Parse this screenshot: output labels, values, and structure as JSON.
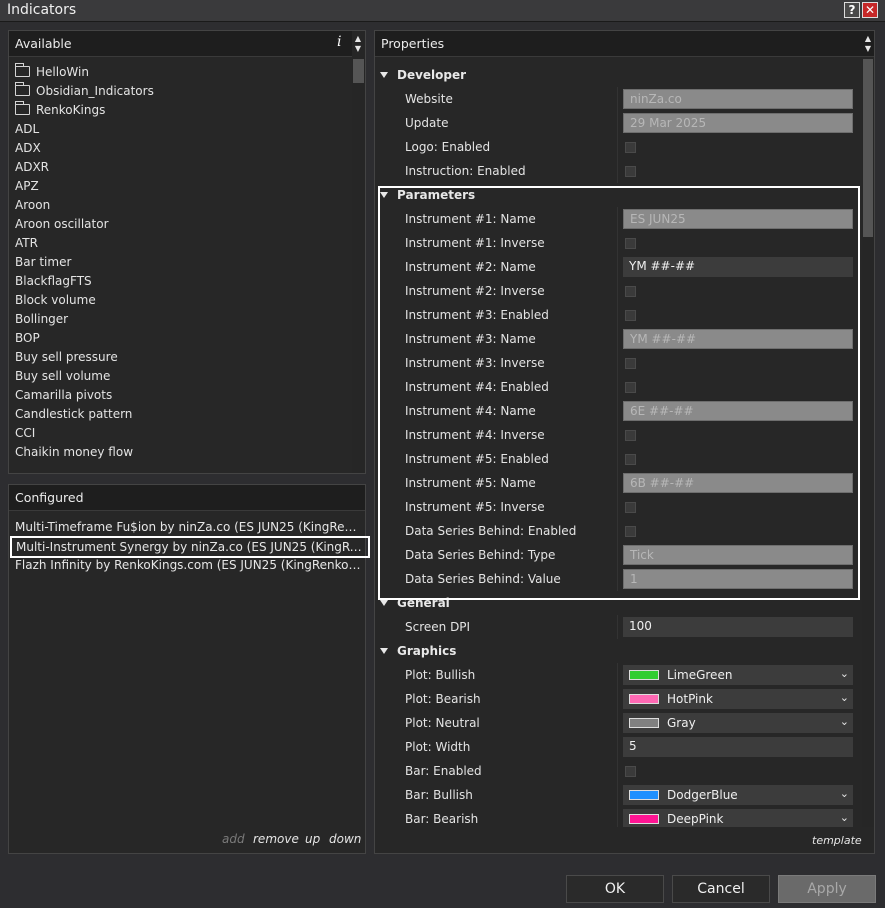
{
  "window": {
    "title": "Indicators",
    "help_label": "?",
    "close_label": "✕"
  },
  "available": {
    "header": "Available",
    "info_label": "i",
    "items": [
      {
        "label": "HelloWin",
        "folder": true
      },
      {
        "label": "Obsidian_Indicators",
        "folder": true
      },
      {
        "label": "RenkoKings",
        "folder": true
      },
      {
        "label": "ADL"
      },
      {
        "label": "ADX"
      },
      {
        "label": "ADXR"
      },
      {
        "label": "APZ"
      },
      {
        "label": "Aroon"
      },
      {
        "label": "Aroon oscillator"
      },
      {
        "label": "ATR"
      },
      {
        "label": "Bar timer"
      },
      {
        "label": "BlackflagFTS"
      },
      {
        "label": "Block volume"
      },
      {
        "label": "Bollinger"
      },
      {
        "label": "BOP"
      },
      {
        "label": "Buy sell pressure"
      },
      {
        "label": "Buy sell volume"
      },
      {
        "label": "Camarilla pivots"
      },
      {
        "label": "Candlestick pattern"
      },
      {
        "label": "CCI"
      },
      {
        "label": "Chaikin money flow"
      }
    ]
  },
  "configured": {
    "header": "Configured",
    "items": [
      "Multi-Timeframe Fu$ion by ninZa.co (ES JUN25 (KingRenko$ 1...",
      "Multi-Instrument Synergy by ninZa.co (ES JUN25 (KingRenko$ 1...",
      "Flazh Infinity by RenkoKings.com (ES JUN25 (KingRenko$ 1..."
    ],
    "selected_index": 1,
    "links": {
      "add": "add",
      "remove": "remove",
      "up": "up",
      "down": "down"
    }
  },
  "properties": {
    "header": "Properties",
    "template_label": "template",
    "categories": {
      "developer": "Developer",
      "parameters": "Parameters",
      "general": "General",
      "graphics": "Graphics"
    },
    "developer": [
      {
        "name": "Website",
        "kind": "text",
        "value": "ninZa.co",
        "enabled": false
      },
      {
        "name": "Update",
        "kind": "text",
        "value": "29 Mar 2025",
        "enabled": false
      },
      {
        "name": "Logo: Enabled",
        "kind": "check"
      },
      {
        "name": "Instruction: Enabled",
        "kind": "check"
      }
    ],
    "parameters": [
      {
        "name": "Instrument #1: Name",
        "kind": "text",
        "value": "ES JUN25",
        "enabled": false
      },
      {
        "name": "Instrument #1: Inverse",
        "kind": "check"
      },
      {
        "name": "Instrument #2: Name",
        "kind": "text",
        "value": "YM ##-##",
        "enabled": true
      },
      {
        "name": "Instrument #2: Inverse",
        "kind": "check"
      },
      {
        "name": "Instrument #3: Enabled",
        "kind": "check"
      },
      {
        "name": "Instrument #3: Name",
        "kind": "text",
        "value": "YM ##-##",
        "enabled": false
      },
      {
        "name": "Instrument #3: Inverse",
        "kind": "check"
      },
      {
        "name": "Instrument #4: Enabled",
        "kind": "check"
      },
      {
        "name": "Instrument #4: Name",
        "kind": "text",
        "value": "6E ##-##",
        "enabled": false
      },
      {
        "name": "Instrument #4: Inverse",
        "kind": "check"
      },
      {
        "name": "Instrument #5: Enabled",
        "kind": "check"
      },
      {
        "name": "Instrument #5: Name",
        "kind": "text",
        "value": "6B ##-##",
        "enabled": false
      },
      {
        "name": "Instrument #5: Inverse",
        "kind": "check"
      },
      {
        "name": "Data Series Behind: Enabled",
        "kind": "check"
      },
      {
        "name": "Data Series Behind: Type",
        "kind": "text",
        "value": "Tick",
        "enabled": false
      },
      {
        "name": "Data Series Behind: Value",
        "kind": "text",
        "value": "1",
        "enabled": false
      }
    ],
    "general": [
      {
        "name": "Screen DPI",
        "kind": "text",
        "value": "100",
        "enabled": true
      }
    ],
    "graphics": [
      {
        "name": "Plot: Bullish",
        "kind": "color",
        "value": "LimeGreen",
        "color": "#32cd32"
      },
      {
        "name": "Plot: Bearish",
        "kind": "color",
        "value": "HotPink",
        "color": "#ff69b4"
      },
      {
        "name": "Plot: Neutral",
        "kind": "color",
        "value": "Gray",
        "color": "#808080"
      },
      {
        "name": "Plot: Width",
        "kind": "text",
        "value": "5",
        "enabled": true
      },
      {
        "name": "Bar: Enabled",
        "kind": "check"
      },
      {
        "name": "Bar: Bullish",
        "kind": "color",
        "value": "DodgerBlue",
        "color": "#1e90ff"
      },
      {
        "name": "Bar: Bearish",
        "kind": "color",
        "value": "DeepPink",
        "color": "#ff1493"
      }
    ]
  },
  "buttons": {
    "ok": "OK",
    "cancel": "Cancel",
    "apply": "Apply"
  }
}
